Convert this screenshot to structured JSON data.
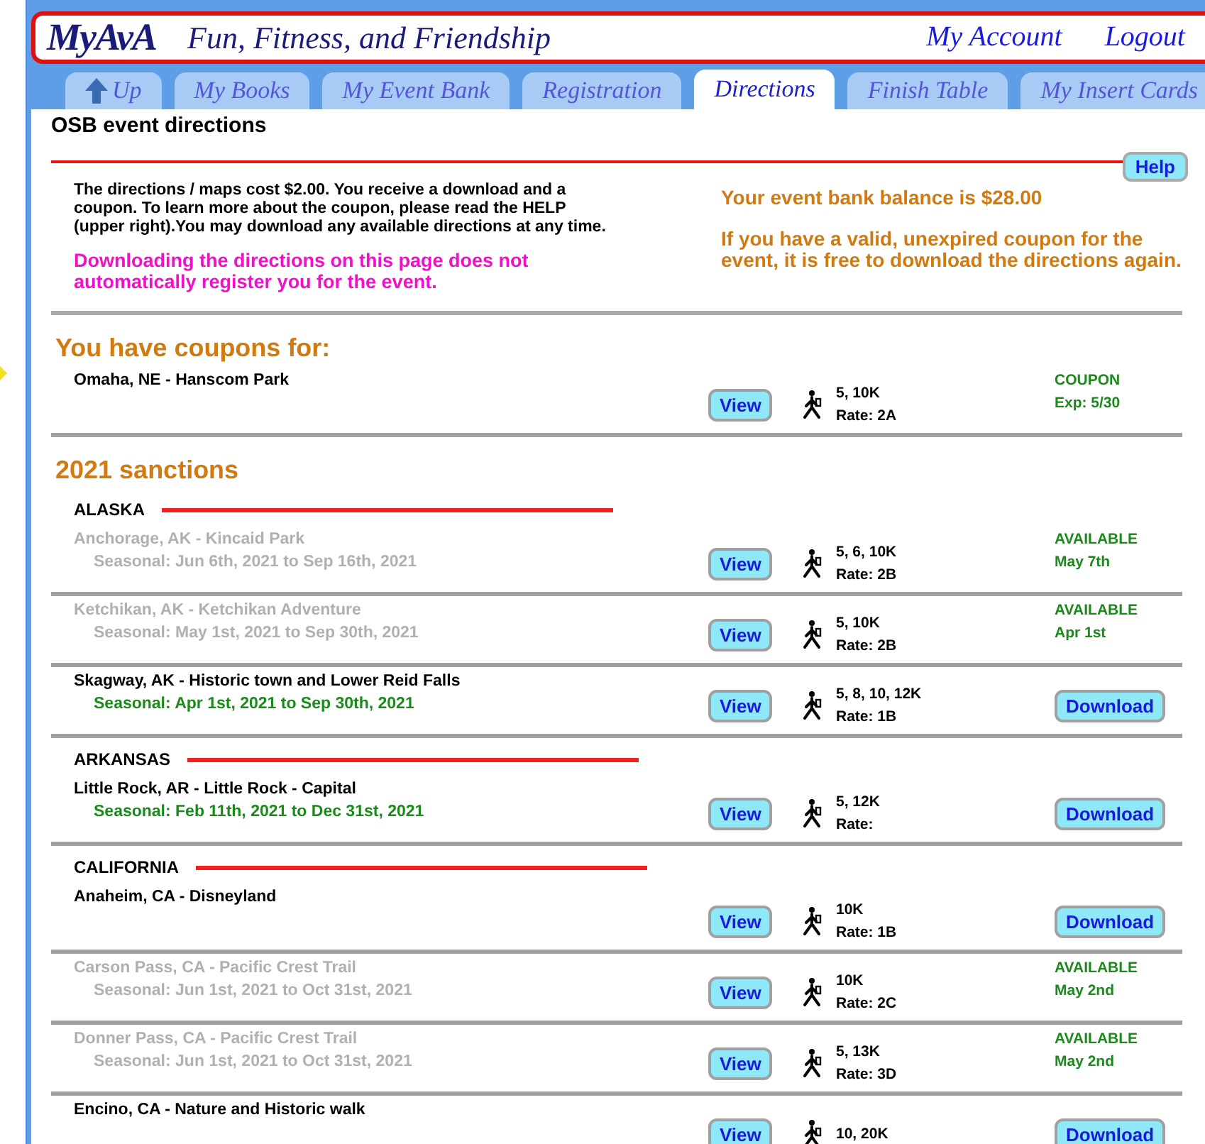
{
  "header": {
    "logo": "MyAvA",
    "tagline": "Fun, Fitness, and Friendship",
    "links": [
      "My Account",
      "Logout"
    ]
  },
  "tabs": [
    {
      "label": "Up",
      "kind": "up",
      "selected": false
    },
    {
      "label": "My Books",
      "kind": "link",
      "selected": false
    },
    {
      "label": "My Event Bank",
      "kind": "link",
      "selected": false
    },
    {
      "label": "Registration",
      "kind": "link",
      "selected": false
    },
    {
      "label": "Directions",
      "kind": "link",
      "selected": true
    },
    {
      "label": "Finish Table",
      "kind": "link",
      "selected": false
    },
    {
      "label": "My Insert Cards",
      "kind": "link",
      "selected": false
    }
  ],
  "page": {
    "title": "OSB event directions",
    "help": "Help"
  },
  "intro": {
    "cost_text": "The directions / maps cost $2.00. You receive a download and a coupon. To learn more about the coupon, please read the HELP (upper right).You may download any available directions at any time.",
    "warning": "Downloading the directions on this page does not automatically register you for the event.",
    "balance": "Your event bank balance is $28.00",
    "coupon_note": "If you have a valid, unexpired coupon for the event, it is free to download the directions again."
  },
  "coupons": {
    "heading": "You have coupons for:",
    "events": [
      {
        "name": "Omaha, NE - Hanscom Park",
        "disabled": false,
        "view": "View",
        "distances": "5, 10K",
        "rate": "Rate: 2A",
        "kind": "coupon",
        "status": "COUPON",
        "date": "Exp: 5/30"
      }
    ]
  },
  "sanctions": {
    "heading": "2021 sanctions",
    "states": [
      {
        "name": "ALASKA",
        "events": [
          {
            "name": "Anchorage, AK - Kincaid Park",
            "season": "Seasonal: Jun 6th, 2021 to Sep 16th, 2021",
            "disabled": true,
            "view": "View",
            "distances": "5, 6, 10K",
            "rate": "Rate: 2B",
            "kind": "available",
            "status": "AVAILABLE",
            "date": "May 7th"
          },
          {
            "name": "Ketchikan, AK - Ketchikan Adventure",
            "season": "Seasonal: May 1st, 2021 to Sep 30th, 2021",
            "disabled": true,
            "view": "View",
            "distances": "5, 10K",
            "rate": "Rate: 2B",
            "kind": "available",
            "status": "AVAILABLE",
            "date": "Apr 1st"
          },
          {
            "name": "Skagway, AK - Historic town and Lower Reid Falls",
            "season": "Seasonal: Apr 1st, 2021 to Sep 30th, 2021",
            "disabled": false,
            "view": "View",
            "distances": "5, 8, 10, 12K",
            "rate": "Rate: 1B",
            "kind": "download",
            "action": "Download"
          }
        ]
      },
      {
        "name": "ARKANSAS",
        "events": [
          {
            "name": "Little Rock, AR - Little Rock - Capital",
            "season": "Seasonal: Feb 11th, 2021 to Dec 31st, 2021",
            "disabled": false,
            "view": "View",
            "distances": "5, 12K",
            "rate": "Rate:",
            "kind": "download",
            "action": "Download"
          }
        ]
      },
      {
        "name": "CALIFORNIA",
        "events": [
          {
            "name": "Anaheim, CA - Disneyland",
            "disabled": false,
            "view": "View",
            "distances": "10K",
            "rate": "Rate: 1B",
            "kind": "download",
            "action": "Download"
          },
          {
            "name": "Carson Pass, CA - Pacific Crest Trail",
            "season": "Seasonal: Jun 1st, 2021 to Oct 31st, 2021",
            "disabled": true,
            "view": "View",
            "distances": "10K",
            "rate": "Rate: 2C",
            "kind": "available",
            "status": "AVAILABLE",
            "date": "May 2nd"
          },
          {
            "name": "Donner Pass, CA - Pacific Crest Trail",
            "season": "Seasonal: Jun 1st, 2021 to Oct 31st, 2021",
            "disabled": true,
            "view": "View",
            "distances": "5, 13K",
            "rate": "Rate: 3D",
            "kind": "available",
            "status": "AVAILABLE",
            "date": "May 2nd"
          },
          {
            "name": "Encino, CA - Nature and Historic walk",
            "disabled": false,
            "view": "View",
            "distances": "10, 20K",
            "kind": "download",
            "action": "Download"
          }
        ]
      }
    ]
  }
}
